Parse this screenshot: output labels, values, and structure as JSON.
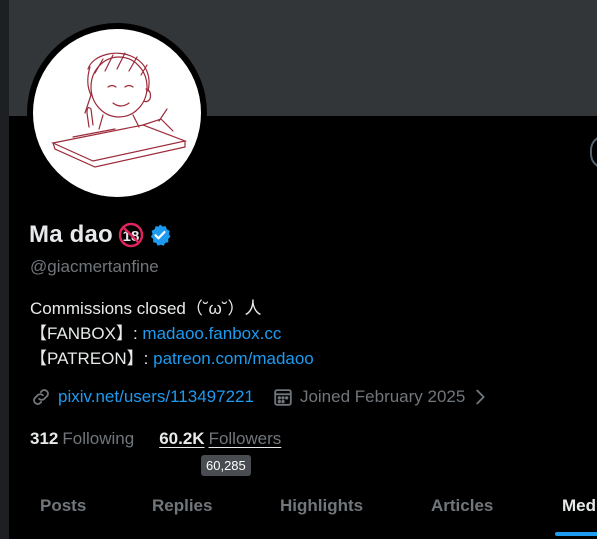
{
  "profile": {
    "display_name": "Ma dao",
    "handle": "@giacmertanfine",
    "bio_line1": "Commissions closed（˘ω˘）人",
    "bio_line2_prefix": "【FANBOX】: ",
    "bio_line2_link": "madaoo.fanbox.cc",
    "bio_line3_prefix": "【PATREON】: ",
    "bio_line3_link": "patreon.com/madaoo",
    "website": "pixiv.net/users/113497221",
    "joined": "Joined February 2025"
  },
  "stats": {
    "following_count": "312",
    "following_label": "Following",
    "followers_count": "60.2K",
    "followers_label": "Followers",
    "followers_tooltip": "60,285"
  },
  "tabs": [
    "Posts",
    "Replies",
    "Highlights",
    "Articles",
    "Med"
  ],
  "colors": {
    "accent": "#1d9bf0",
    "background": "#000000",
    "banner": "#333639",
    "muted_text": "#71767b"
  },
  "icons": {
    "verified": "verified-badge-icon",
    "age": "age-18-badge-icon",
    "link": "link-icon",
    "calendar": "calendar-icon",
    "chevron": "chevron-right-icon"
  }
}
